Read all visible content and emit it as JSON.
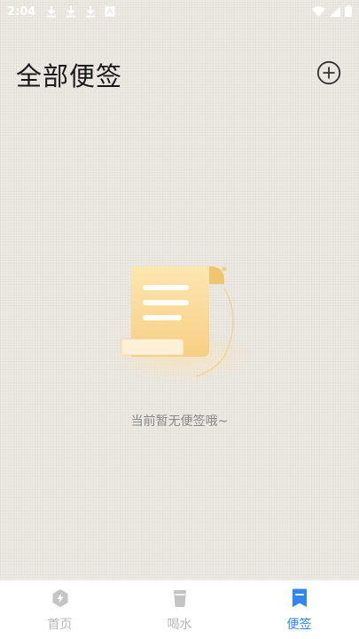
{
  "status_bar": {
    "time": "2:04",
    "notification_icons": [
      "download-icon",
      "download-icon",
      "download-icon",
      "app-icon"
    ],
    "right_icons": [
      "wifi-icon",
      "signal-icon",
      "battery-icon"
    ]
  },
  "header": {
    "title": "全部便签",
    "add_icon": "plus-circle-icon"
  },
  "empty_state": {
    "illustration": "scroll-paper-icon",
    "message": "当前暂无便签哦~"
  },
  "tab_bar": {
    "tabs": [
      {
        "label": "首页",
        "icon": "home-bolt-icon",
        "active": false
      },
      {
        "label": "喝水",
        "icon": "water-cup-icon",
        "active": false
      },
      {
        "label": "便签",
        "icon": "note-bookmark-icon",
        "active": true
      }
    ]
  },
  "colors": {
    "background": "#ece8e2",
    "accent": "#2f86f0",
    "tab_inactive": "#b8b8b8",
    "scroll_paper": "#fbe0a2"
  }
}
